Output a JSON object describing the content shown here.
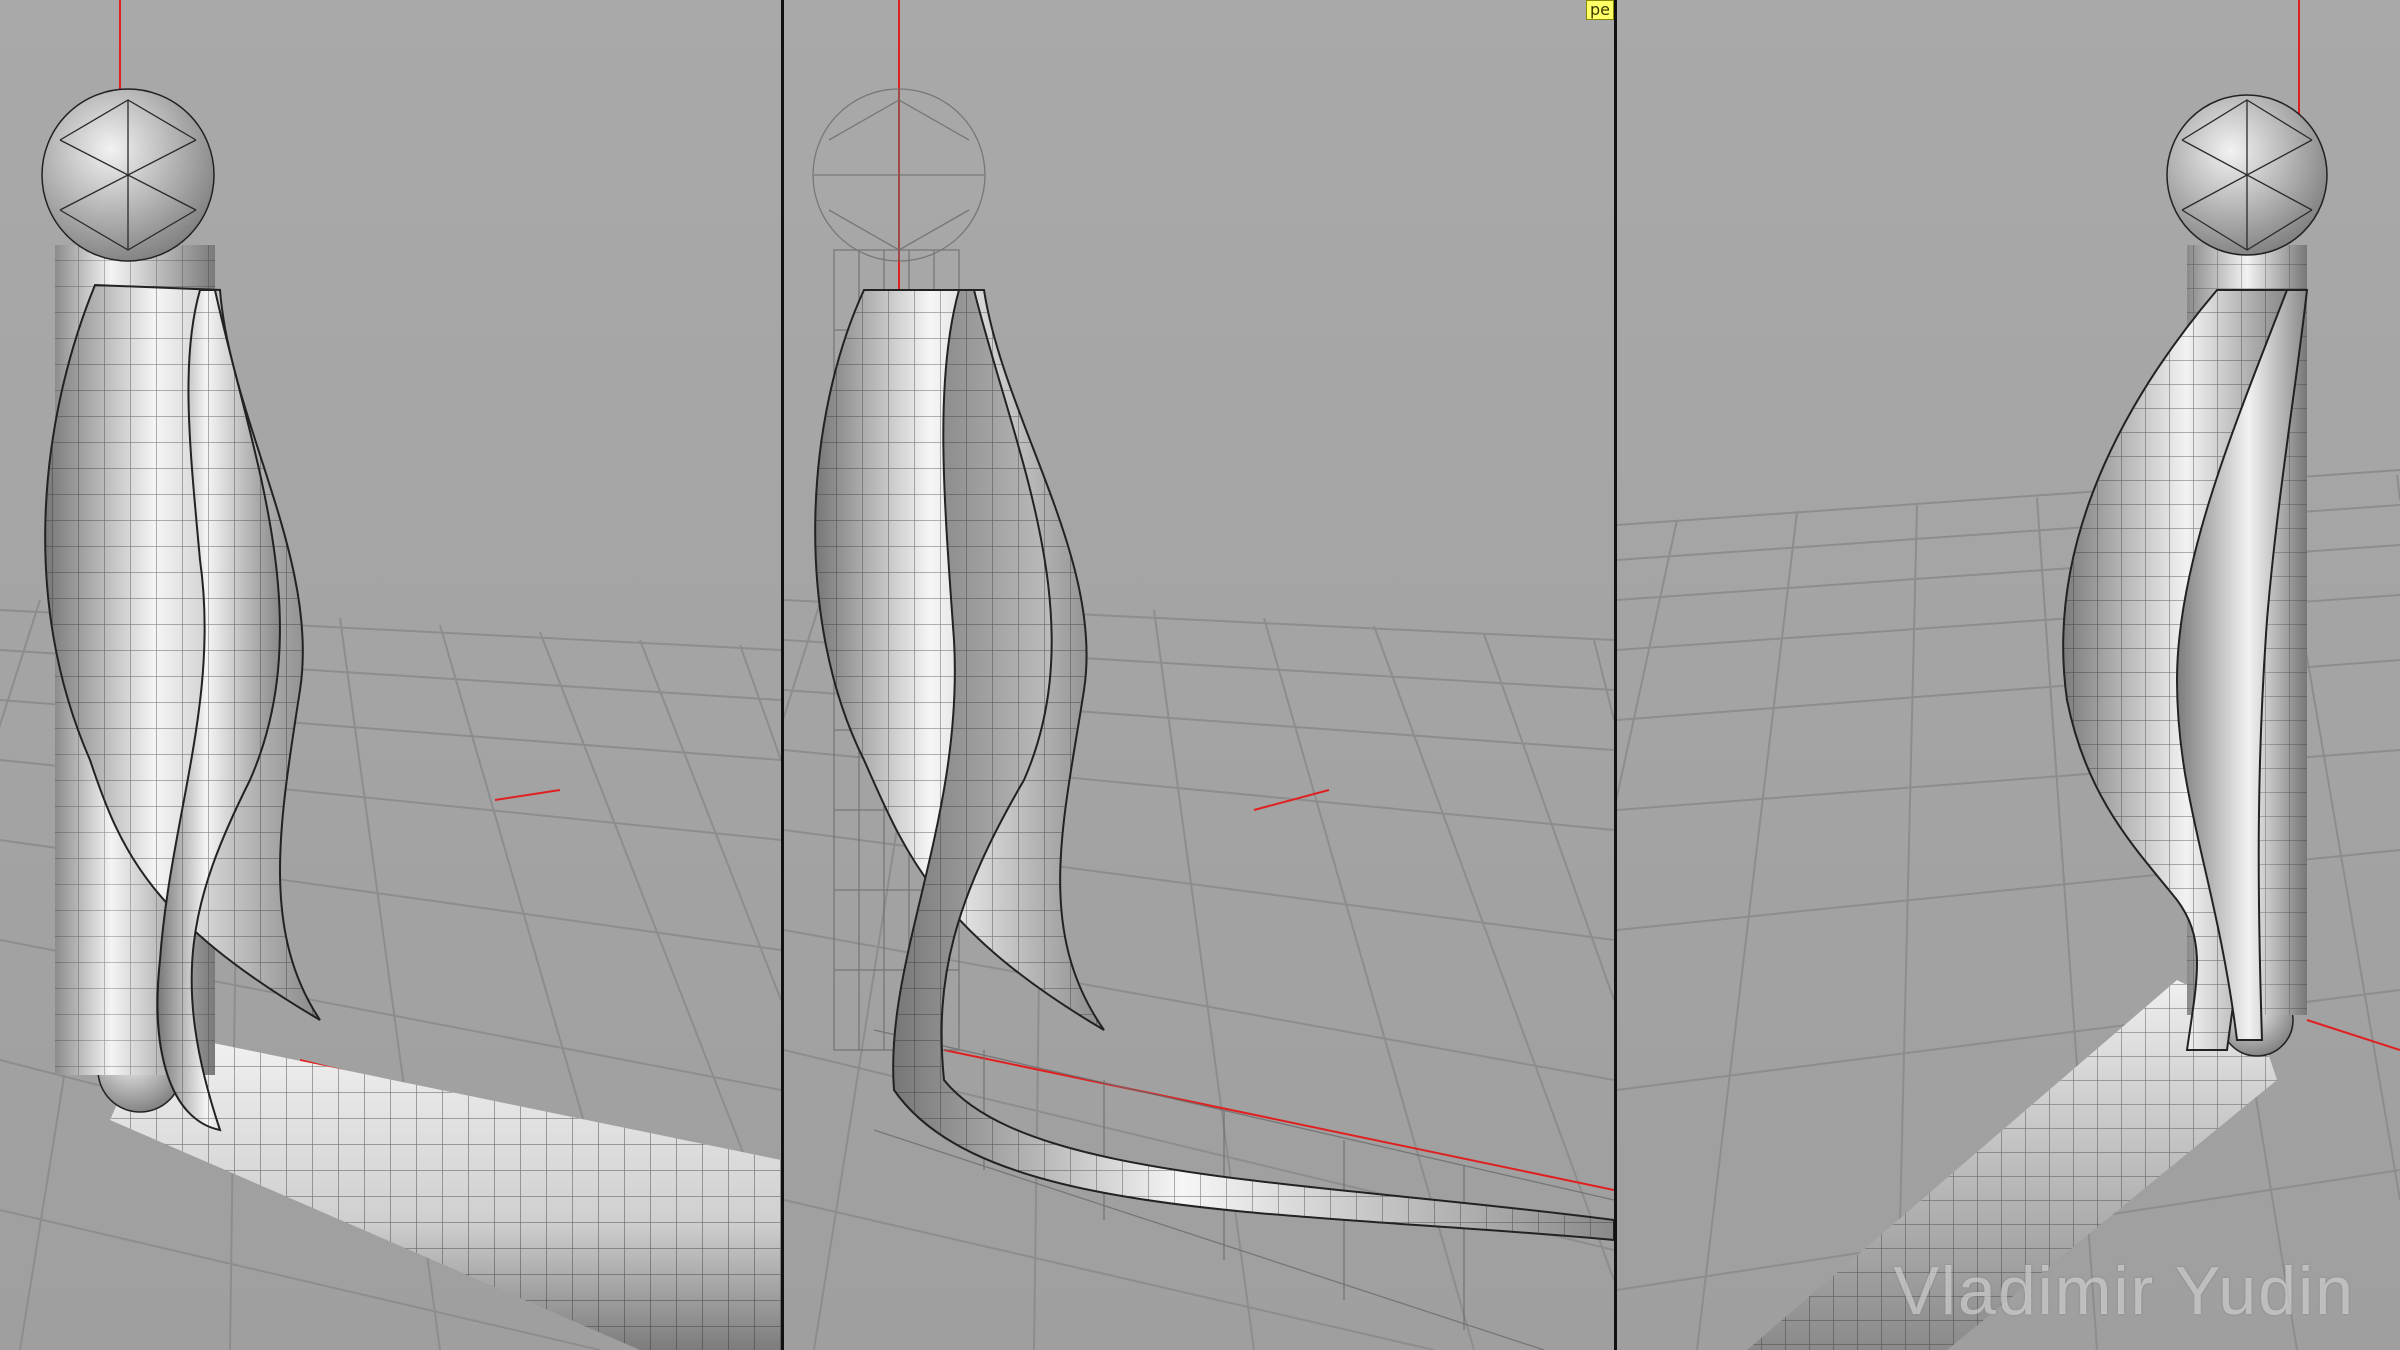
{
  "viewports": [
    {
      "id": "left",
      "mode": "shaded-wireframe"
    },
    {
      "id": "center",
      "mode": "shaded-wireframe-with-xray",
      "camera_label": "pe"
    },
    {
      "id": "right",
      "mode": "shaded-wireframe"
    }
  ],
  "watermark": "Vladimir Yudin",
  "colors": {
    "background": "#a6a6a6",
    "grid": "#8a8a8a",
    "axis": "#e02020",
    "mesh_fill": "#e6e6e6",
    "mesh_line": "#222222",
    "divider": "#111111",
    "camera_label_bg": "#ffff66"
  }
}
